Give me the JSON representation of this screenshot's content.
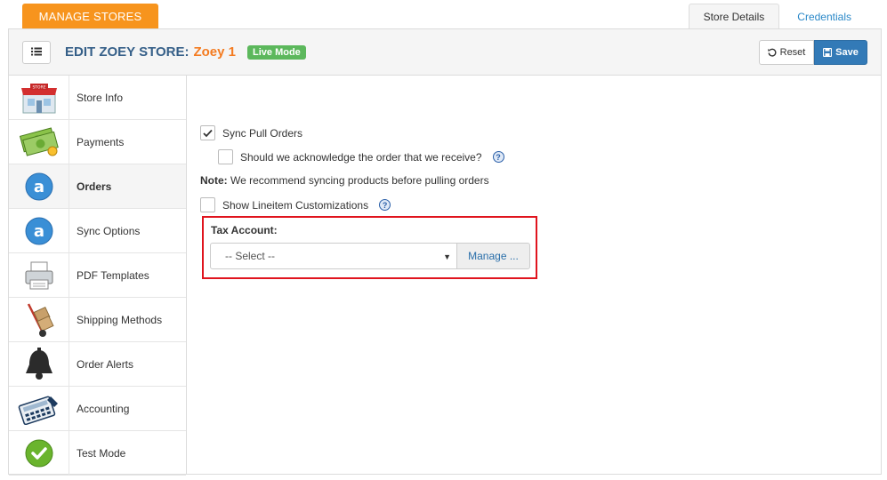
{
  "top_tab": {
    "label": "MANAGE STORES"
  },
  "detail_tabs": [
    {
      "label": "Store Details",
      "active": true
    },
    {
      "label": "Credentials",
      "active": false
    }
  ],
  "header": {
    "title_prefix": "EDIT ZOEY STORE:",
    "store_name": "Zoey 1",
    "badge": "Live Mode",
    "reset_label": "Reset",
    "save_label": "Save"
  },
  "sidebar": {
    "items": [
      {
        "label": "Store Info",
        "icon": "store-icon",
        "active": false
      },
      {
        "label": "Payments",
        "icon": "money-icon",
        "active": false
      },
      {
        "label": "Orders",
        "icon": "zoey-a-icon",
        "active": true
      },
      {
        "label": "Sync Options",
        "icon": "zoey-a-icon",
        "active": false
      },
      {
        "label": "PDF Templates",
        "icon": "printer-icon",
        "active": false
      },
      {
        "label": "Shipping Methods",
        "icon": "hand-truck-icon",
        "active": false
      },
      {
        "label": "Order Alerts",
        "icon": "bell-icon",
        "active": false
      },
      {
        "label": "Accounting",
        "icon": "calculator-icon",
        "active": false
      },
      {
        "label": "Test Mode",
        "icon": "check-circle-icon",
        "active": false
      }
    ]
  },
  "orders": {
    "sync_pull_label": "Sync Pull Orders",
    "sync_pull_checked": true,
    "acknowledge_label": "Should we acknowledge the order that we receive?",
    "acknowledge_checked": false,
    "note_bold": "Note:",
    "note_text": " We recommend syncing products before pulling orders",
    "lineitem_label": "Show Lineitem Customizations",
    "lineitem_checked": false,
    "tax_account_label": "Tax Account:",
    "tax_select_value": "-- Select --",
    "manage_label": "Manage ..."
  },
  "colors": {
    "accent_orange": "#f7941d",
    "title_blue": "#355f88",
    "save_blue": "#337ab7",
    "live_green": "#5cb85c",
    "highlight_red": "#e0141e"
  }
}
